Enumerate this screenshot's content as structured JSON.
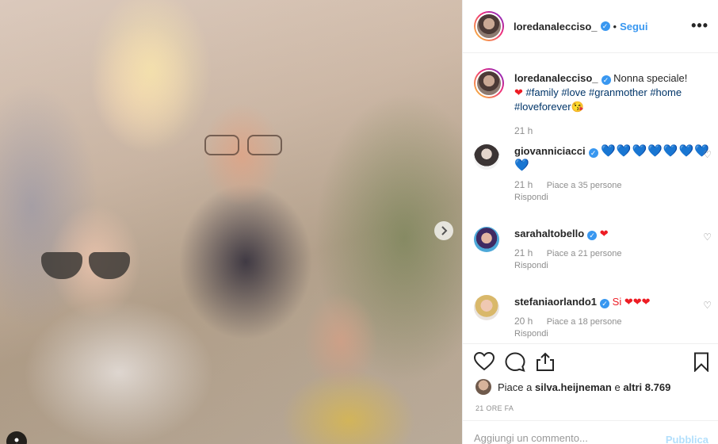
{
  "post": {
    "username": "loredanalecciso_",
    "follow_label": "Segui",
    "more_label": "•••",
    "caption_text": "Nonna speciale!",
    "caption_tags": "#family #love #granmother #home #loveforever",
    "caption_time": "21 h"
  },
  "comments": [
    {
      "username": "giovanniciacci",
      "text": "💙💙💙💙💙💙💙💙",
      "time": "21 h",
      "likes": "Piace a 35 persone",
      "reply": "Rispondi",
      "verified": true
    },
    {
      "username": "sarahaltobello",
      "text": "❤",
      "time": "21 h",
      "likes": "Piace a 21 persone",
      "reply": "Rispondi",
      "verified": true
    },
    {
      "username": "stefaniaorlando1",
      "text": "Si ❤❤❤",
      "time": "20 h",
      "likes": "Piace a 18 persone",
      "reply": "Rispondi",
      "verified": true
    }
  ],
  "likes": {
    "prefix": "Piace a",
    "first_user": "silva.heijneman",
    "connector": "e",
    "others": "altri 8.769"
  },
  "posted_ago": "21 ORE FA",
  "add_comment": {
    "placeholder": "Aggiungi un commento...",
    "publish_label": "Pubblica"
  },
  "colors": {
    "accent_blue": "#3897f0",
    "heart_red": "#ed1c24",
    "heart_blue": "#1da1f2",
    "muted_text": "#8e8e8e"
  },
  "icons": [
    "verified-badge-icon",
    "more-options-icon",
    "heart-outline-icon",
    "comment-icon",
    "share-icon",
    "bookmark-icon",
    "chevron-right-icon",
    "user-tag-icon"
  ]
}
